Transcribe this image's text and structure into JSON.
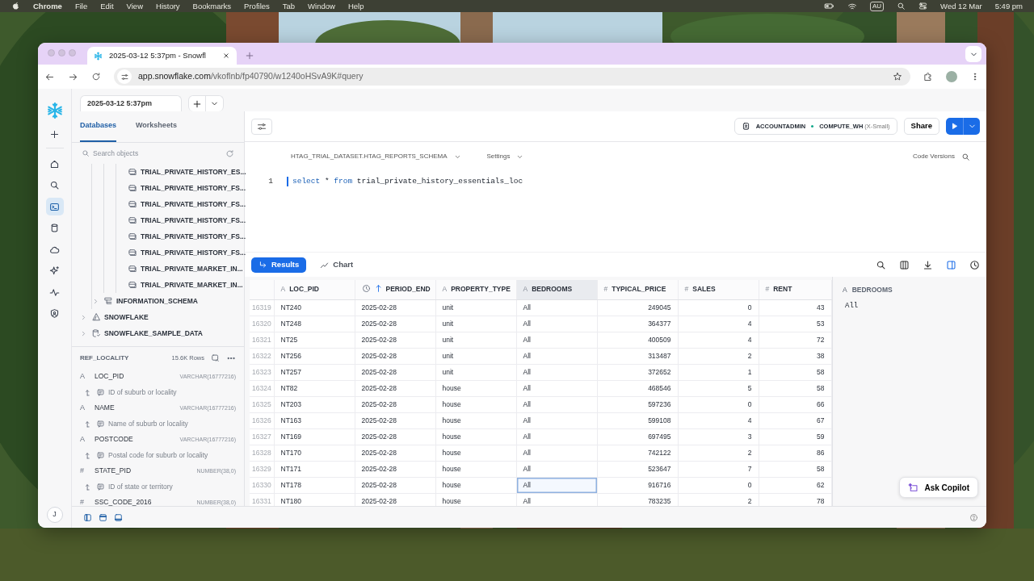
{
  "menu_bar": {
    "app": "Chrome",
    "menus": [
      "File",
      "Edit",
      "View",
      "History",
      "Bookmarks",
      "Profiles",
      "Tab",
      "Window",
      "Help"
    ],
    "input_source": "AU",
    "date": "Wed 12 Mar",
    "time": "5:49 pm"
  },
  "browser": {
    "tab_title": "2025-03-12 5:37pm - Snowfl",
    "url_host": "app.snowflake.com",
    "url_path": "/vkoflnb/fp40790/w1240oHSvA9K#query"
  },
  "rail": [
    {
      "kind": "home",
      "selected": false
    },
    {
      "kind": "search",
      "selected": false
    },
    {
      "kind": "worksheets",
      "selected": true
    },
    {
      "kind": "data",
      "selected": false
    },
    {
      "kind": "cloud",
      "selected": false
    },
    {
      "kind": "ai",
      "selected": false
    },
    {
      "kind": "monitoring",
      "selected": false
    },
    {
      "kind": "admin",
      "selected": false
    }
  ],
  "user_initial": "J",
  "worksheet_tabs": [
    {
      "label": "2025-03-12 5:37pm",
      "selected": true
    }
  ],
  "sidebar": {
    "tabs": [
      {
        "label": "Databases",
        "selected": true
      },
      {
        "label": "Worksheets",
        "selected": false
      }
    ],
    "search_placeholder": "Search objects",
    "tree": [
      {
        "children": [
          {
            "children": [
              {
                "children": [
                  {
                    "label": "TRIAL_PRIVATE_HISTORY_ES...",
                    "kind": "table"
                  },
                  {
                    "label": "TRIAL_PRIVATE_HISTORY_FS...",
                    "kind": "table"
                  },
                  {
                    "label": "TRIAL_PRIVATE_HISTORY_FS...",
                    "kind": "table"
                  },
                  {
                    "label": "TRIAL_PRIVATE_HISTORY_FS...",
                    "kind": "table"
                  },
                  {
                    "label": "TRIAL_PRIVATE_HISTORY_FS...",
                    "kind": "table"
                  },
                  {
                    "label": "TRIAL_PRIVATE_HISTORY_FS...",
                    "kind": "table"
                  },
                  {
                    "label": "TRIAL_PRIVATE_MARKET_IN...",
                    "kind": "table"
                  },
                  {
                    "label": "TRIAL_PRIVATE_MARKET_IN...",
                    "kind": "table"
                  }
                ]
              }
            ]
          },
          {
            "label": "INFORMATION_SCHEMA",
            "kind": "schema",
            "expanded": false
          }
        ]
      },
      {
        "label": "SNOWFLAKE",
        "kind": "shared_database",
        "expanded": false
      },
      {
        "label": "SNOWFLAKE_SAMPLE_DATA",
        "kind": "database",
        "expanded": false
      }
    ],
    "details": {
      "title": "REF_LOCALITY",
      "row_count": "15.6K Rows",
      "columns": [
        {
          "icon": "A",
          "name": "LOC_PID",
          "type": "VARCHAR(16777216)",
          "description": "ID of suburb or locality"
        },
        {
          "icon": "A",
          "name": "NAME",
          "type": "VARCHAR(16777216)",
          "description": "Name of suburb or locality"
        },
        {
          "icon": "A",
          "name": "POSTCODE",
          "type": "VARCHAR(16777216)",
          "description": "Postal code for suburb or locality"
        },
        {
          "icon": "#",
          "name": "STATE_PID",
          "type": "NUMBER(38,0)",
          "description": "ID of state or territory"
        },
        {
          "icon": "#",
          "name": "SSC_CODE_2016",
          "type": "NUMBER(38,0)"
        }
      ]
    }
  },
  "toolbar": {
    "role": "ACCOUNTADMIN",
    "warehouse": "COMPUTE_WH",
    "warehouse_size": "(X-Small)",
    "share": "Share"
  },
  "context": {
    "schema": "HTAG_TRIAL_DATASET.HTAG_REPORTS_SCHEMA",
    "settings": "Settings",
    "code_versions": "Code Versions"
  },
  "editor": {
    "lines": [
      {
        "number": "1",
        "tokens": [
          {
            "text": "select",
            "kind": "keyword"
          },
          {
            "text": "*",
            "kind": "plain"
          },
          {
            "text": "from",
            "kind": "keyword"
          },
          {
            "text": "trial_private_history_essentials_loc",
            "kind": "plain"
          }
        ]
      }
    ]
  },
  "result_tabs": [
    {
      "label": "Results",
      "kind": "results",
      "selected": true
    },
    {
      "label": "Chart",
      "kind": "chart",
      "selected": false
    }
  ],
  "table": {
    "columns": [
      {
        "name": "LOC_PID",
        "kind": "text",
        "icon": "A",
        "sorted": false,
        "selected": false
      },
      {
        "name": "PERIOD_END",
        "kind": "date",
        "sorted": true,
        "selected": false
      },
      {
        "name": "PROPERTY_TYPE",
        "kind": "text",
        "icon": "A",
        "sorted": false,
        "selected": false
      },
      {
        "name": "BEDROOMS",
        "kind": "text",
        "icon": "A",
        "sorted": false,
        "selected": true
      },
      {
        "name": "TYPICAL_PRICE",
        "kind": "number",
        "icon": "#",
        "sorted": false,
        "selected": false
      },
      {
        "name": "SALES",
        "kind": "number",
        "icon": "#",
        "sorted": false,
        "selected": false
      },
      {
        "name": "RENT",
        "kind": "number",
        "icon": "#",
        "sorted": false,
        "selected": false
      }
    ],
    "rows": [
      {
        "number": "16319",
        "cells": [
          "NT240",
          "2025-02-28",
          "unit",
          "All",
          "249045",
          "0",
          "43"
        ],
        "focused": false
      },
      {
        "number": "16320",
        "cells": [
          "NT248",
          "2025-02-28",
          "unit",
          "All",
          "364377",
          "4",
          "53"
        ],
        "focused": false
      },
      {
        "number": "16321",
        "cells": [
          "NT25",
          "2025-02-28",
          "unit",
          "All",
          "400509",
          "4",
          "72"
        ],
        "focused": false
      },
      {
        "number": "16322",
        "cells": [
          "NT256",
          "2025-02-28",
          "unit",
          "All",
          "313487",
          "2",
          "38"
        ],
        "focused": false
      },
      {
        "number": "16323",
        "cells": [
          "NT257",
          "2025-02-28",
          "unit",
          "All",
          "372652",
          "1",
          "58"
        ],
        "focused": false
      },
      {
        "number": "16324",
        "cells": [
          "NT82",
          "2025-02-28",
          "house",
          "All",
          "468546",
          "5",
          "58"
        ],
        "focused": false
      },
      {
        "number": "16325",
        "cells": [
          "NT203",
          "2025-02-28",
          "house",
          "All",
          "597236",
          "0",
          "66"
        ],
        "focused": false
      },
      {
        "number": "16326",
        "cells": [
          "NT163",
          "2025-02-28",
          "house",
          "All",
          "599108",
          "4",
          "67"
        ],
        "focused": false
      },
      {
        "number": "16327",
        "cells": [
          "NT169",
          "2025-02-28",
          "house",
          "All",
          "697495",
          "3",
          "59"
        ],
        "focused": false
      },
      {
        "number": "16328",
        "cells": [
          "NT170",
          "2025-02-28",
          "house",
          "All",
          "742122",
          "2",
          "86"
        ],
        "focused": false
      },
      {
        "number": "16329",
        "cells": [
          "NT171",
          "2025-02-28",
          "house",
          "All",
          "523647",
          "7",
          "58"
        ],
        "focused": false
      },
      {
        "number": "16330",
        "cells": [
          "NT178",
          "2025-02-28",
          "house",
          "All",
          "916716",
          "0",
          "62"
        ],
        "focused": true
      },
      {
        "number": "16331",
        "cells": [
          "NT180",
          "2025-02-28",
          "house",
          "All",
          "783235",
          "2",
          "78"
        ],
        "focused": false
      }
    ]
  },
  "cell_detail": {
    "icon": "A",
    "column": "BEDROOMS",
    "value": "All"
  },
  "copilot": "Ask Copilot"
}
